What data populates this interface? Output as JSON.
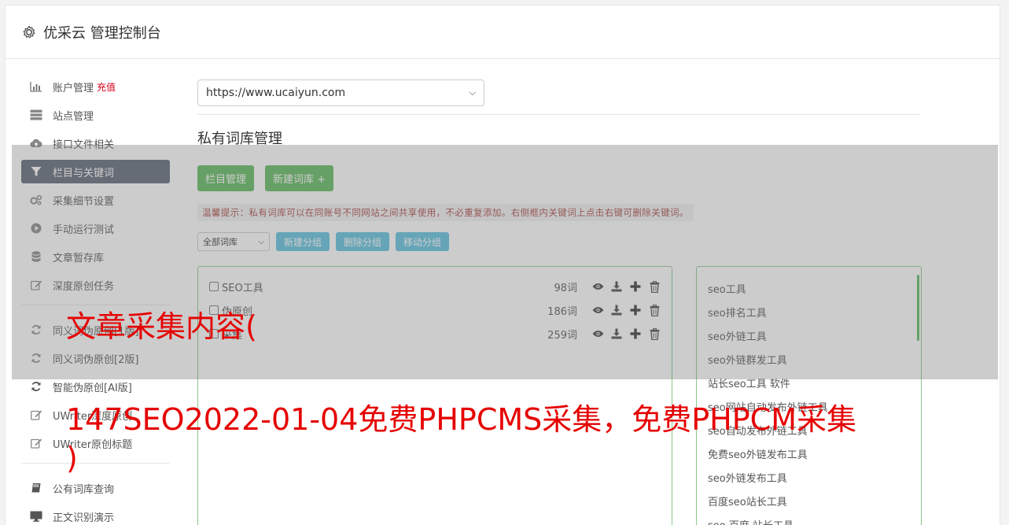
{
  "header": {
    "title": "优采云 管理控制台"
  },
  "sidebar": {
    "items": [
      {
        "label": "账户管理",
        "badge": "充值",
        "icon": "bar-chart-icon"
      },
      {
        "label": "站点管理",
        "icon": "server-icon"
      },
      {
        "label": "接口文件相关",
        "icon": "cloud-upload-icon"
      },
      {
        "label": "栏目与关键词",
        "icon": "filter-icon",
        "active": true
      },
      {
        "label": "采集细节设置",
        "icon": "cogs-icon"
      },
      {
        "label": "手动运行测试",
        "icon": "play-circle-icon"
      },
      {
        "label": "文章暂存库",
        "icon": "database-icon"
      },
      {
        "label": "深度原创任务",
        "icon": "edit-icon"
      },
      {
        "label": "同义词伪原创[1版]",
        "icon": "refresh-icon"
      },
      {
        "label": "同义词伪原创[2版]",
        "icon": "refresh-icon"
      },
      {
        "label": "智能伪原创[AI版]",
        "icon": "refresh-icon"
      },
      {
        "label": "UWriter深度原创",
        "icon": "edit-icon"
      },
      {
        "label": "UWriter原创标题",
        "icon": "edit-icon"
      },
      {
        "label": "公有词库查询",
        "icon": "book-icon"
      },
      {
        "label": "正文识别演示",
        "icon": "monitor-icon"
      }
    ]
  },
  "main": {
    "site_select": "https://www.ucaiyun.com",
    "section_title": "私有词库管理",
    "btn_columns": "栏目管理",
    "btn_new_lib": "新建词库 +",
    "tip": "温馨提示：私有词库可以在同账号不同网站之间共享使用，不必重复添加。右侧框内关键词上点击右键可删除关键词。",
    "filter_select": "全部词库",
    "btn_new_group": "新建分组",
    "btn_delete_group": "删除分组",
    "btn_move_group": "移动分组",
    "libraries": [
      {
        "name": "SEO工具",
        "count": "98词"
      },
      {
        "name": "伪原创",
        "count": "186词"
      },
      {
        "name": "采集",
        "count": "259词"
      }
    ],
    "keywords": [
      "seo工具",
      "seo排名工具",
      "seo外链工具",
      "seo外链群发工具",
      "站长seo工具 软件",
      "seo网站自动发布外链工具",
      "seo自动发布外链工具",
      "免费seo外链发布工具",
      "seo外链发布工具",
      "百度seo站长工具",
      "seo 百度 站长工具"
    ]
  },
  "watermark": {
    "line1": "文章采集内容(",
    "line2": "147SEO2022-01-04免费PHPCMS采集，免费PHPCM采集",
    "line3": ")"
  }
}
